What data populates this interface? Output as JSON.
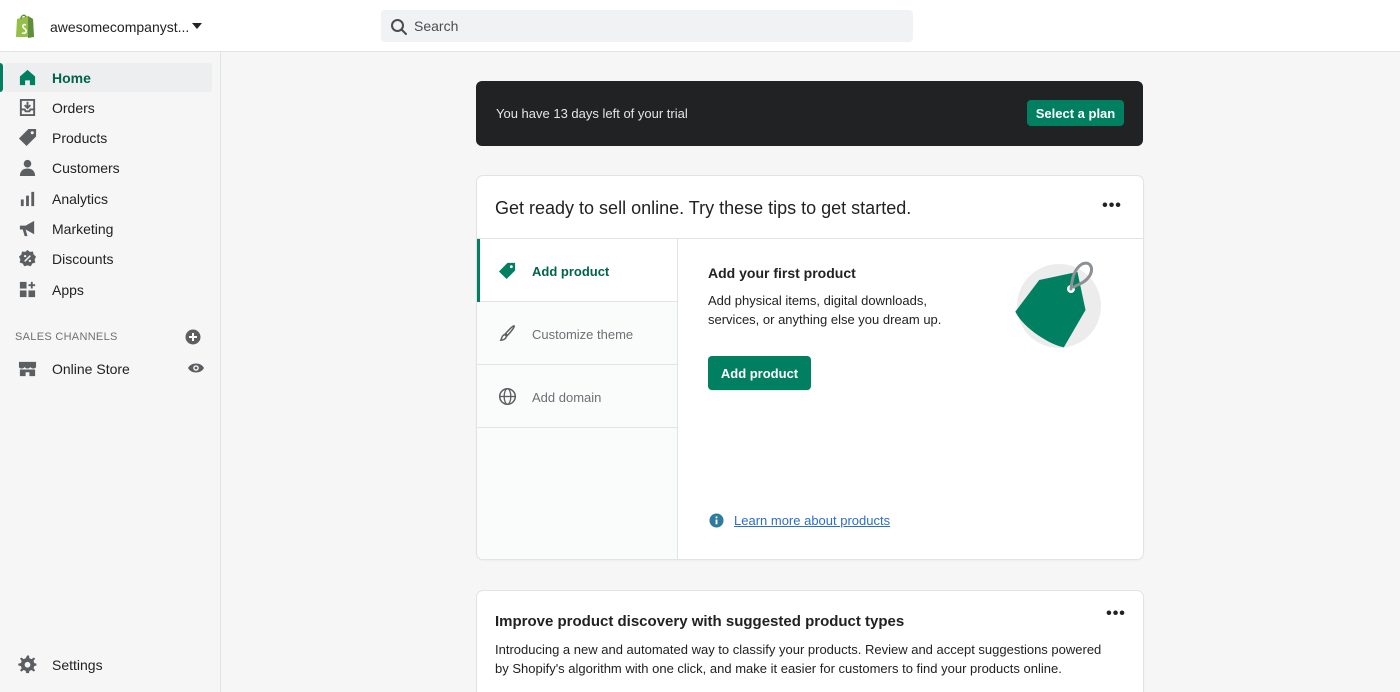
{
  "topbar": {
    "store_name": "awesomecompanyst...",
    "search_placeholder": "Search"
  },
  "sidebar": {
    "items": [
      {
        "label": "Home",
        "icon": "home-icon",
        "active": true
      },
      {
        "label": "Orders",
        "icon": "orders-icon"
      },
      {
        "label": "Products",
        "icon": "tag-icon"
      },
      {
        "label": "Customers",
        "icon": "person-icon"
      },
      {
        "label": "Analytics",
        "icon": "bar-chart-icon"
      },
      {
        "label": "Marketing",
        "icon": "megaphone-icon"
      },
      {
        "label": "Discounts",
        "icon": "discount-icon"
      },
      {
        "label": "Apps",
        "icon": "apps-icon"
      }
    ],
    "sales_channels_title": "SALES CHANNELS",
    "online_store_label": "Online Store",
    "settings_label": "Settings"
  },
  "trial": {
    "text": "You have 13 days left of your trial",
    "button": "Select a plan"
  },
  "tips": {
    "title": "Get ready to sell online. Try these tips to get started.",
    "tabs": [
      {
        "label": "Add product"
      },
      {
        "label": "Customize theme"
      },
      {
        "label": "Add domain"
      }
    ],
    "content_title": "Add your first product",
    "content_desc": "Add physical items, digital downloads, services, or anything else you dream up.",
    "button": "Add product",
    "learn_more": "Learn more about products"
  },
  "discovery": {
    "title": "Improve product discovery with suggested product types",
    "desc": "Introducing a new and automated way to classify your products. Review and accept suggestions powered by Shopify's algorithm with one click, and make it easier for customers to find your products online."
  },
  "colors": {
    "accent": "#008060",
    "banner_bg": "#202223",
    "link": "#2c6ecb"
  }
}
